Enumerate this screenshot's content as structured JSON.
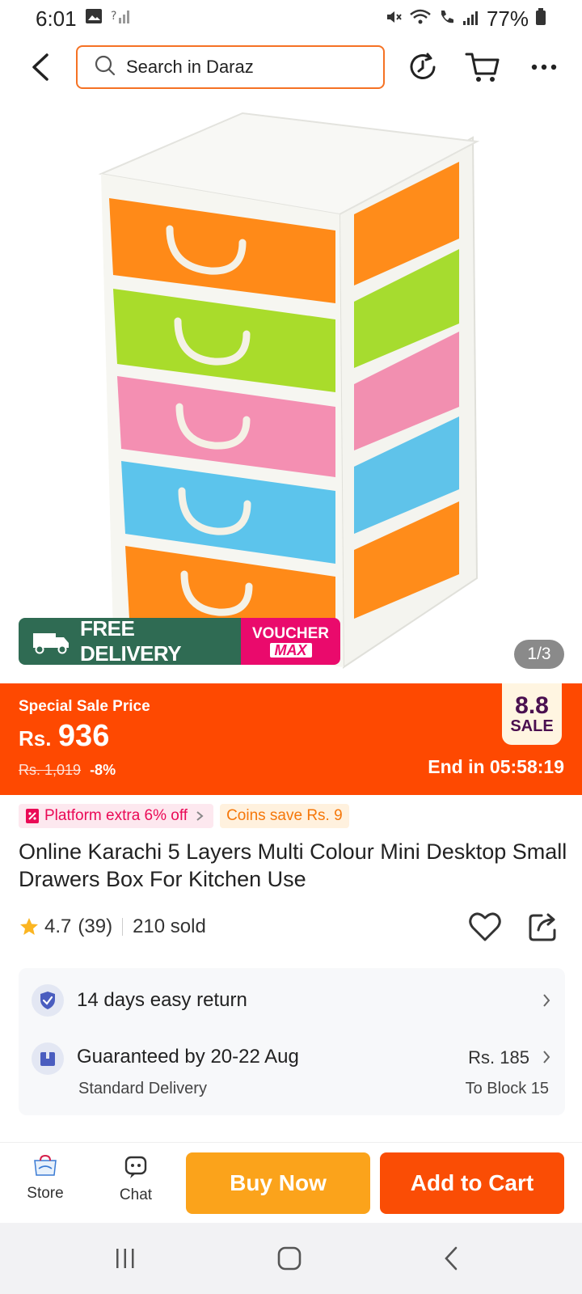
{
  "status_bar": {
    "time": "6:01",
    "battery": "77%"
  },
  "search": {
    "placeholder": "Search in Daraz"
  },
  "badges": {
    "free_small": "FREE",
    "free_delivery": "FREE DELIVERY",
    "voucher_top": "VOUCHER",
    "voucher_bottom": "MAX"
  },
  "image_counter": "1/3",
  "price": {
    "label": "Special Sale Price",
    "currency": "Rs.",
    "amount": "936",
    "original": "Rs. 1,019",
    "discount": "-8%",
    "sale_top": "8.8",
    "sale_bottom": "SALE",
    "timer": "End in 05:58:19"
  },
  "promos": {
    "platform": "Platform extra 6% off",
    "coins": "Coins save Rs. 9"
  },
  "product": {
    "title": "Online Karachi 5 Layers Multi Colour Mini Desktop Small Drawers Box For Kitchen Use",
    "rating": "4.7",
    "reviews": "(39)",
    "sold": "210 sold"
  },
  "services": {
    "return": "14 days easy return",
    "delivery": "Guaranteed by 20-22 Aug",
    "delivery_sub": "Standard Delivery",
    "delivery_price": "Rs. 185",
    "delivery_to": "To Block 15"
  },
  "bottom_bar": {
    "store": "Store",
    "chat": "Chat",
    "buy_now": "Buy Now",
    "add_to_cart": "Add to Cart"
  },
  "colors": {
    "accent": "#f57224",
    "price_banner": "#fe4901",
    "buy_now": "#fba31b",
    "add_to_cart": "#fa4d05",
    "free_delivery": "#2f6b53",
    "voucher": "#ea0a6c"
  }
}
